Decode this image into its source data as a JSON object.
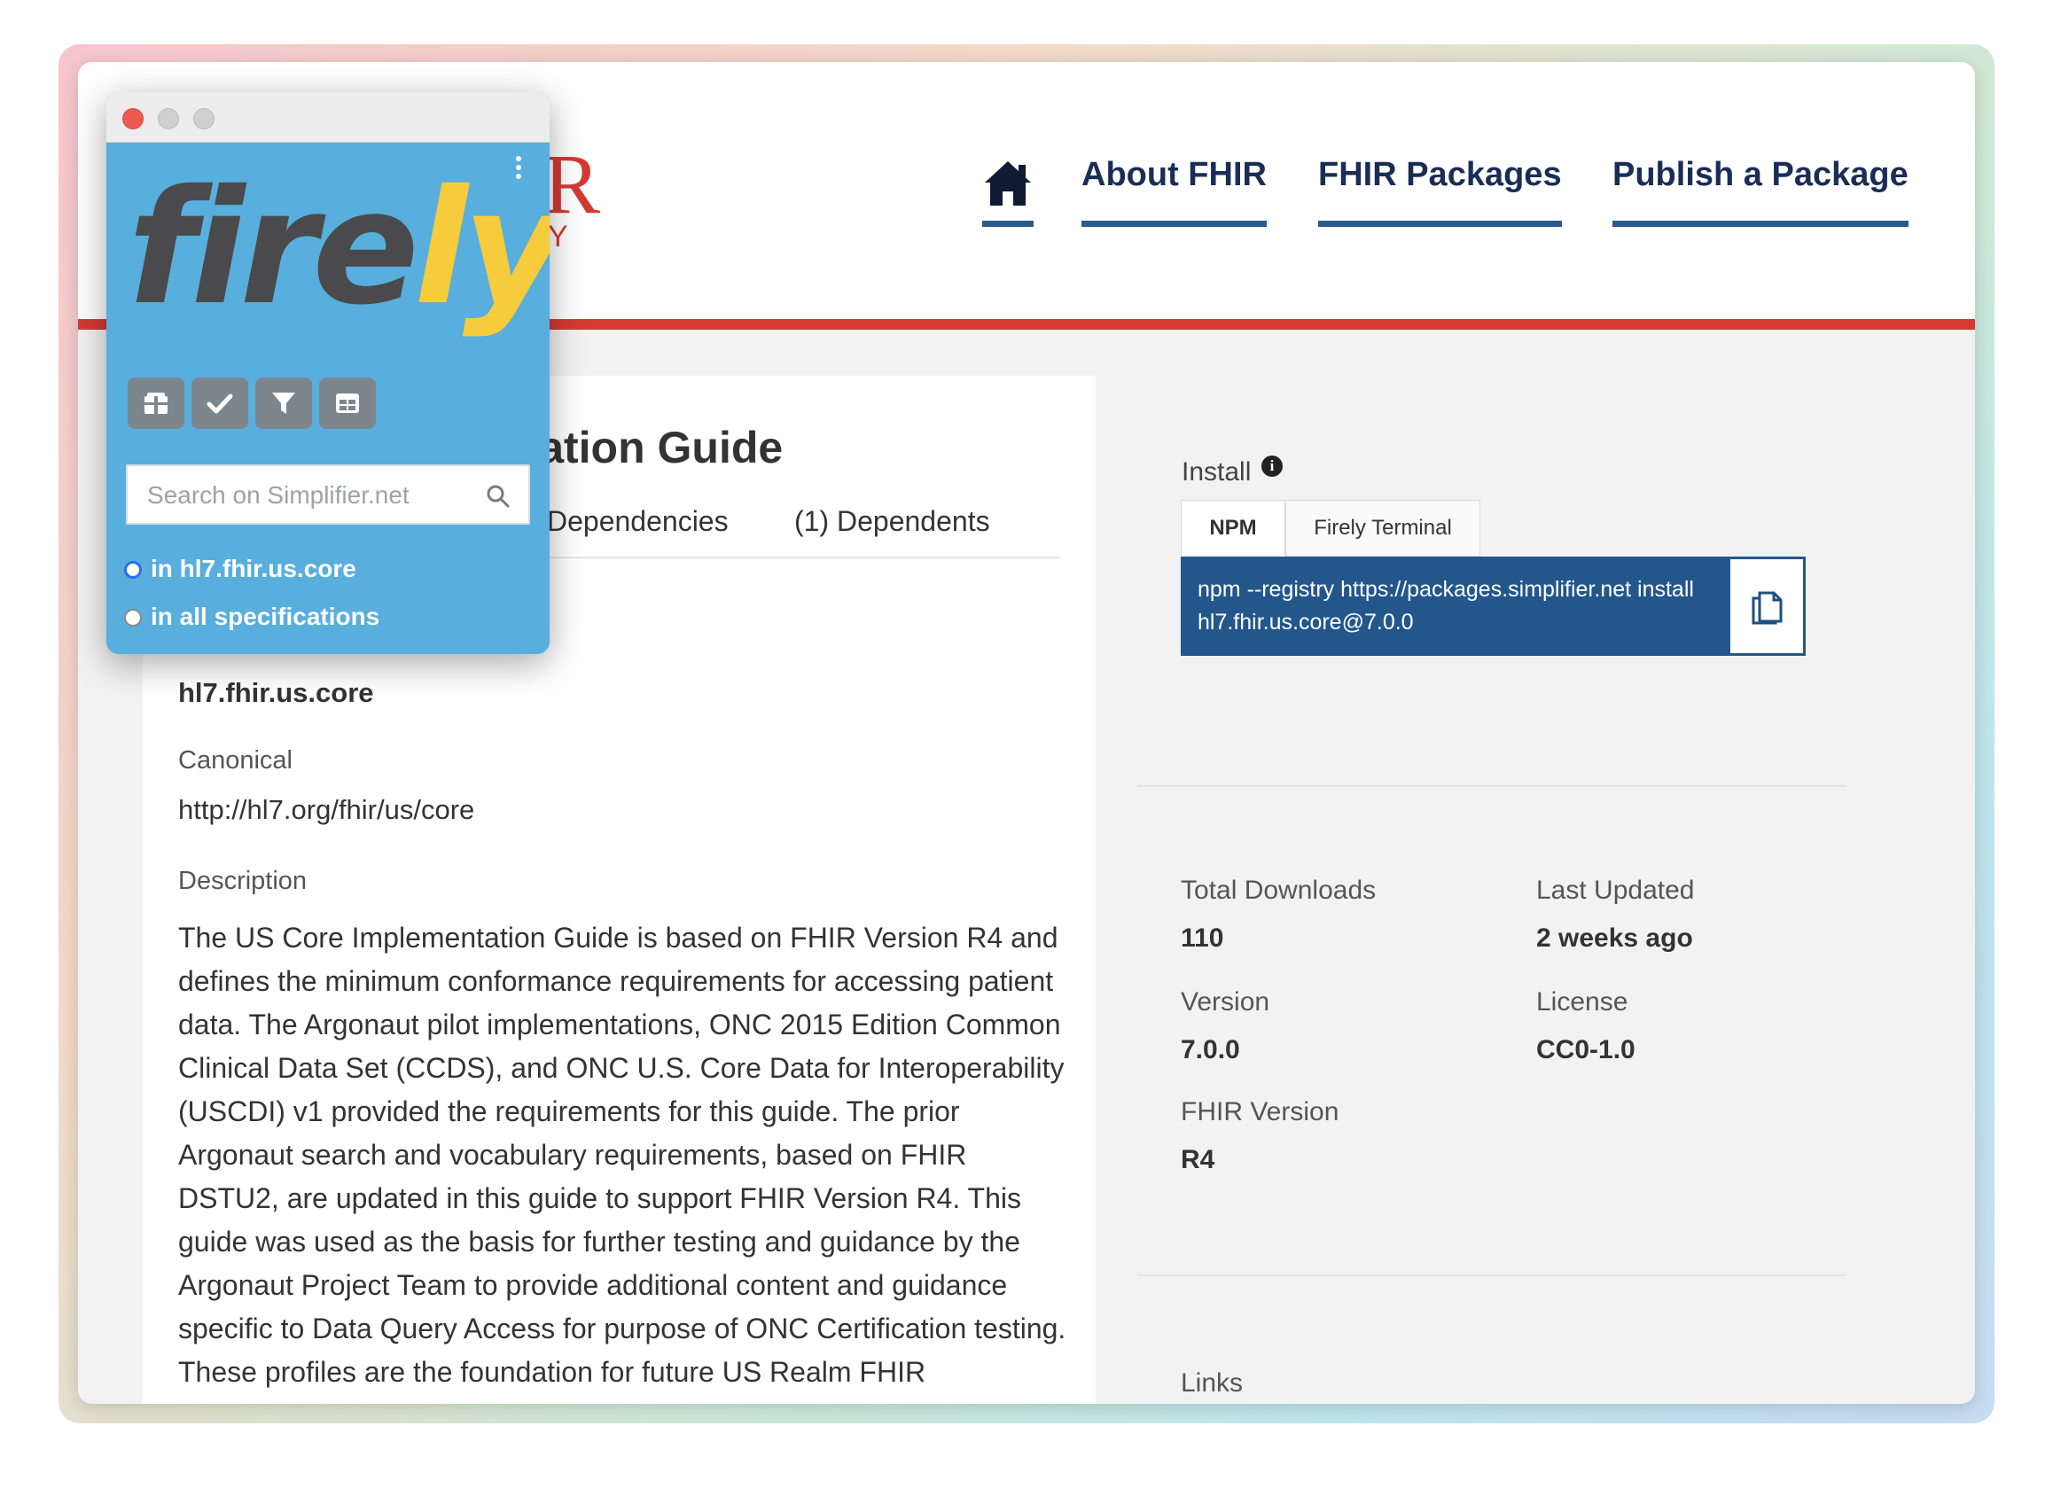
{
  "site": {
    "logo_fragment_r": "R",
    "logo_fragment_y": "Y",
    "nav": {
      "home_icon": "home-icon",
      "items": [
        "About FHIR",
        "FHIR Packages",
        "Publish a Package"
      ]
    }
  },
  "package": {
    "title_visible": "ntation Guide",
    "tabs": [
      "Dependencies",
      "(1) Dependents"
    ],
    "name_partial": "hl7.fhir.us.core",
    "canonical_label": "Canonical",
    "canonical_value": "http://hl7.org/fhir/us/core",
    "description_label": "Description",
    "description": "The US Core Implementation Guide is based on FHIR Version R4 and defines the minimum conformance requirements for accessing patient data. The Argonaut pilot implementations, ONC 2015 Edition Common Clinical Data Set (CCDS), and ONC U.S. Core Data for Interoperability (USCDI) v1 provided the requirements for this guide. The prior Argonaut search and vocabulary requirements, based on FHIR DSTU2, are updated in this guide to support FHIR Version R4. This guide was used as the basis for further testing and guidance by the Argonaut Project Team to provide additional content and guidance specific to Data Query Access for purpose of ONC Certification testing. These profiles are the foundation for future US Realm FHIR implementation guides. In addition to Argonaut, they are used by DAF-Research, QI-Core, and CIMI."
  },
  "install": {
    "label": "Install",
    "info_icon": "info-icon",
    "tabs": [
      "NPM",
      "Firely Terminal"
    ],
    "command": "npm --registry https://packages.simplifier.net install hl7.fhir.us.core@7.0.0",
    "copy_icon": "copy-icon"
  },
  "stats": {
    "total_downloads_label": "Total Downloads",
    "total_downloads": "110",
    "last_updated_label": "Last Updated",
    "last_updated": "2 weeks ago",
    "version_label": "Version",
    "version": "7.0.0",
    "license_label": "License",
    "license": "CC0-1.0",
    "fhir_version_label": "FHIR Version",
    "fhir_version": "R4",
    "links_label": "Links"
  },
  "firely": {
    "wordmark_fire": "fire",
    "wordmark_ly": "ly",
    "toolbar_icons": [
      "package-icon",
      "check-icon",
      "filter-icon",
      "table-icon"
    ],
    "search_placeholder": "Search on Simplifier.net",
    "scope_options": [
      "in hl7.fhir.us.core",
      "in all specifications"
    ],
    "selected_scope": "in hl7.fhir.us.core",
    "colors": {
      "brand_blue": "#58aedc",
      "brand_yellow": "#f6cc3c",
      "brand_gray": "#4a4a4c"
    }
  },
  "colors": {
    "nav_text": "#1a2d57",
    "accent_red": "#d43a34",
    "install_blue": "#23578c"
  }
}
